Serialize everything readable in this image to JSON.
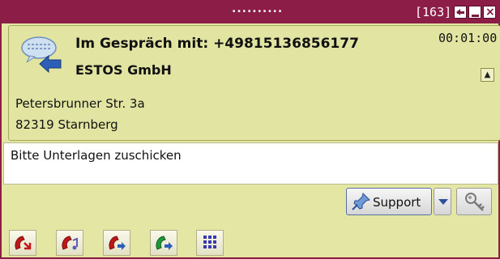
{
  "window": {
    "title": "..........",
    "counter": "[163]"
  },
  "call": {
    "title": "Im Gespräch mit: +49815136856177",
    "company": "ESTOS GmbH",
    "duration": "00:01:00",
    "street": "Petersbrunner Str. 3a",
    "city": "82319 Starnberg"
  },
  "note": {
    "value": "Bitte Unterlagen zuschicken"
  },
  "support": {
    "label": "Support"
  },
  "actions": {
    "icons": [
      "hangup-icon",
      "hold-icon",
      "transfer-icon",
      "forward-icon",
      "keypad-icon"
    ]
  },
  "colors": {
    "titlebar": "#8c1d47",
    "panel": "#e2e5a2",
    "hangup": "#c01818",
    "transfer": "#2c5fb8"
  }
}
